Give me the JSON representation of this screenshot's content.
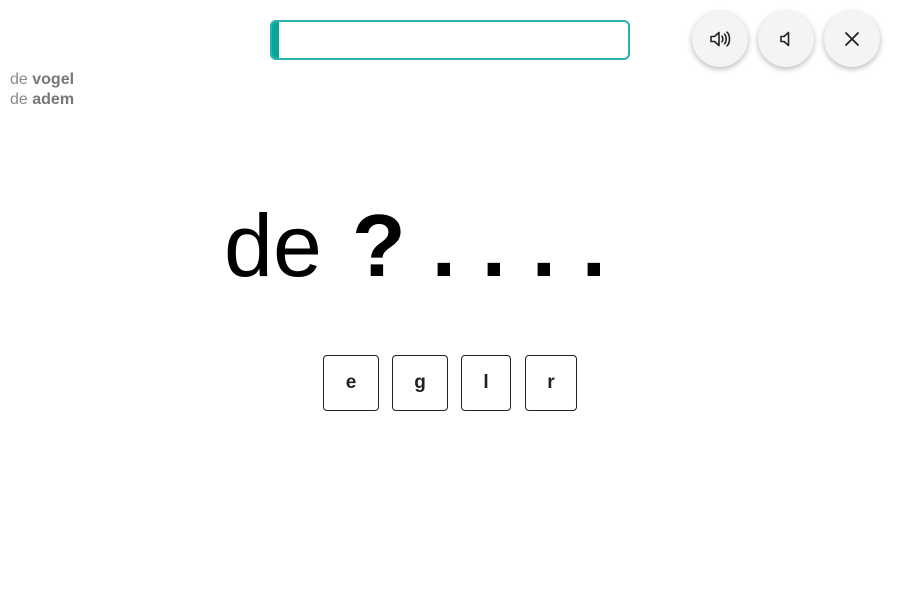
{
  "progress": {
    "fraction": 0.0,
    "fill_color": "#0aa39a",
    "border_color": "#26b3ad"
  },
  "controls": [
    {
      "id": "sound-slow",
      "icon": "speaker-loud-icon"
    },
    {
      "id": "sound-fast",
      "icon": "speaker-soft-icon"
    },
    {
      "id": "close",
      "icon": "close-icon"
    }
  ],
  "word_list": [
    {
      "article": "de",
      "word": "vogel"
    },
    {
      "article": "de",
      "word": "adem"
    }
  ],
  "puzzle": {
    "article": "de",
    "current_slot": "?",
    "remaining_slots": [
      ".",
      ".",
      ".",
      "."
    ]
  },
  "tiles": [
    "e",
    "g",
    "l",
    "r"
  ]
}
